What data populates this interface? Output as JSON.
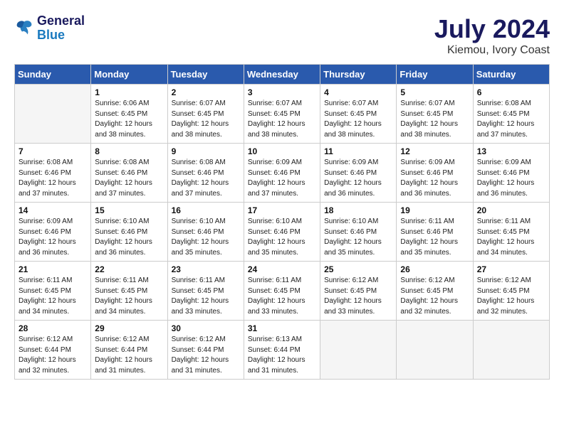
{
  "header": {
    "logo_line1": "General",
    "logo_line2": "Blue",
    "month": "July 2024",
    "location": "Kiemou, Ivory Coast"
  },
  "weekdays": [
    "Sunday",
    "Monday",
    "Tuesday",
    "Wednesday",
    "Thursday",
    "Friday",
    "Saturday"
  ],
  "weeks": [
    [
      {
        "day": "",
        "empty": true
      },
      {
        "day": "1",
        "sunrise": "6:06 AM",
        "sunset": "6:45 PM",
        "daylight": "12 hours and 38 minutes."
      },
      {
        "day": "2",
        "sunrise": "6:07 AM",
        "sunset": "6:45 PM",
        "daylight": "12 hours and 38 minutes."
      },
      {
        "day": "3",
        "sunrise": "6:07 AM",
        "sunset": "6:45 PM",
        "daylight": "12 hours and 38 minutes."
      },
      {
        "day": "4",
        "sunrise": "6:07 AM",
        "sunset": "6:45 PM",
        "daylight": "12 hours and 38 minutes."
      },
      {
        "day": "5",
        "sunrise": "6:07 AM",
        "sunset": "6:45 PM",
        "daylight": "12 hours and 38 minutes."
      },
      {
        "day": "6",
        "sunrise": "6:08 AM",
        "sunset": "6:45 PM",
        "daylight": "12 hours and 37 minutes."
      }
    ],
    [
      {
        "day": "7",
        "sunrise": "6:08 AM",
        "sunset": "6:46 PM",
        "daylight": "12 hours and 37 minutes."
      },
      {
        "day": "8",
        "sunrise": "6:08 AM",
        "sunset": "6:46 PM",
        "daylight": "12 hours and 37 minutes."
      },
      {
        "day": "9",
        "sunrise": "6:08 AM",
        "sunset": "6:46 PM",
        "daylight": "12 hours and 37 minutes."
      },
      {
        "day": "10",
        "sunrise": "6:09 AM",
        "sunset": "6:46 PM",
        "daylight": "12 hours and 37 minutes."
      },
      {
        "day": "11",
        "sunrise": "6:09 AM",
        "sunset": "6:46 PM",
        "daylight": "12 hours and 36 minutes."
      },
      {
        "day": "12",
        "sunrise": "6:09 AM",
        "sunset": "6:46 PM",
        "daylight": "12 hours and 36 minutes."
      },
      {
        "day": "13",
        "sunrise": "6:09 AM",
        "sunset": "6:46 PM",
        "daylight": "12 hours and 36 minutes."
      }
    ],
    [
      {
        "day": "14",
        "sunrise": "6:09 AM",
        "sunset": "6:46 PM",
        "daylight": "12 hours and 36 minutes."
      },
      {
        "day": "15",
        "sunrise": "6:10 AM",
        "sunset": "6:46 PM",
        "daylight": "12 hours and 36 minutes."
      },
      {
        "day": "16",
        "sunrise": "6:10 AM",
        "sunset": "6:46 PM",
        "daylight": "12 hours and 35 minutes."
      },
      {
        "day": "17",
        "sunrise": "6:10 AM",
        "sunset": "6:46 PM",
        "daylight": "12 hours and 35 minutes."
      },
      {
        "day": "18",
        "sunrise": "6:10 AM",
        "sunset": "6:46 PM",
        "daylight": "12 hours and 35 minutes."
      },
      {
        "day": "19",
        "sunrise": "6:11 AM",
        "sunset": "6:46 PM",
        "daylight": "12 hours and 35 minutes."
      },
      {
        "day": "20",
        "sunrise": "6:11 AM",
        "sunset": "6:45 PM",
        "daylight": "12 hours and 34 minutes."
      }
    ],
    [
      {
        "day": "21",
        "sunrise": "6:11 AM",
        "sunset": "6:45 PM",
        "daylight": "12 hours and 34 minutes."
      },
      {
        "day": "22",
        "sunrise": "6:11 AM",
        "sunset": "6:45 PM",
        "daylight": "12 hours and 34 minutes."
      },
      {
        "day": "23",
        "sunrise": "6:11 AM",
        "sunset": "6:45 PM",
        "daylight": "12 hours and 33 minutes."
      },
      {
        "day": "24",
        "sunrise": "6:11 AM",
        "sunset": "6:45 PM",
        "daylight": "12 hours and 33 minutes."
      },
      {
        "day": "25",
        "sunrise": "6:12 AM",
        "sunset": "6:45 PM",
        "daylight": "12 hours and 33 minutes."
      },
      {
        "day": "26",
        "sunrise": "6:12 AM",
        "sunset": "6:45 PM",
        "daylight": "12 hours and 32 minutes."
      },
      {
        "day": "27",
        "sunrise": "6:12 AM",
        "sunset": "6:45 PM",
        "daylight": "12 hours and 32 minutes."
      }
    ],
    [
      {
        "day": "28",
        "sunrise": "6:12 AM",
        "sunset": "6:44 PM",
        "daylight": "12 hours and 32 minutes."
      },
      {
        "day": "29",
        "sunrise": "6:12 AM",
        "sunset": "6:44 PM",
        "daylight": "12 hours and 31 minutes."
      },
      {
        "day": "30",
        "sunrise": "6:12 AM",
        "sunset": "6:44 PM",
        "daylight": "12 hours and 31 minutes."
      },
      {
        "day": "31",
        "sunrise": "6:13 AM",
        "sunset": "6:44 PM",
        "daylight": "12 hours and 31 minutes."
      },
      {
        "day": "",
        "empty": true
      },
      {
        "day": "",
        "empty": true
      },
      {
        "day": "",
        "empty": true
      }
    ]
  ]
}
